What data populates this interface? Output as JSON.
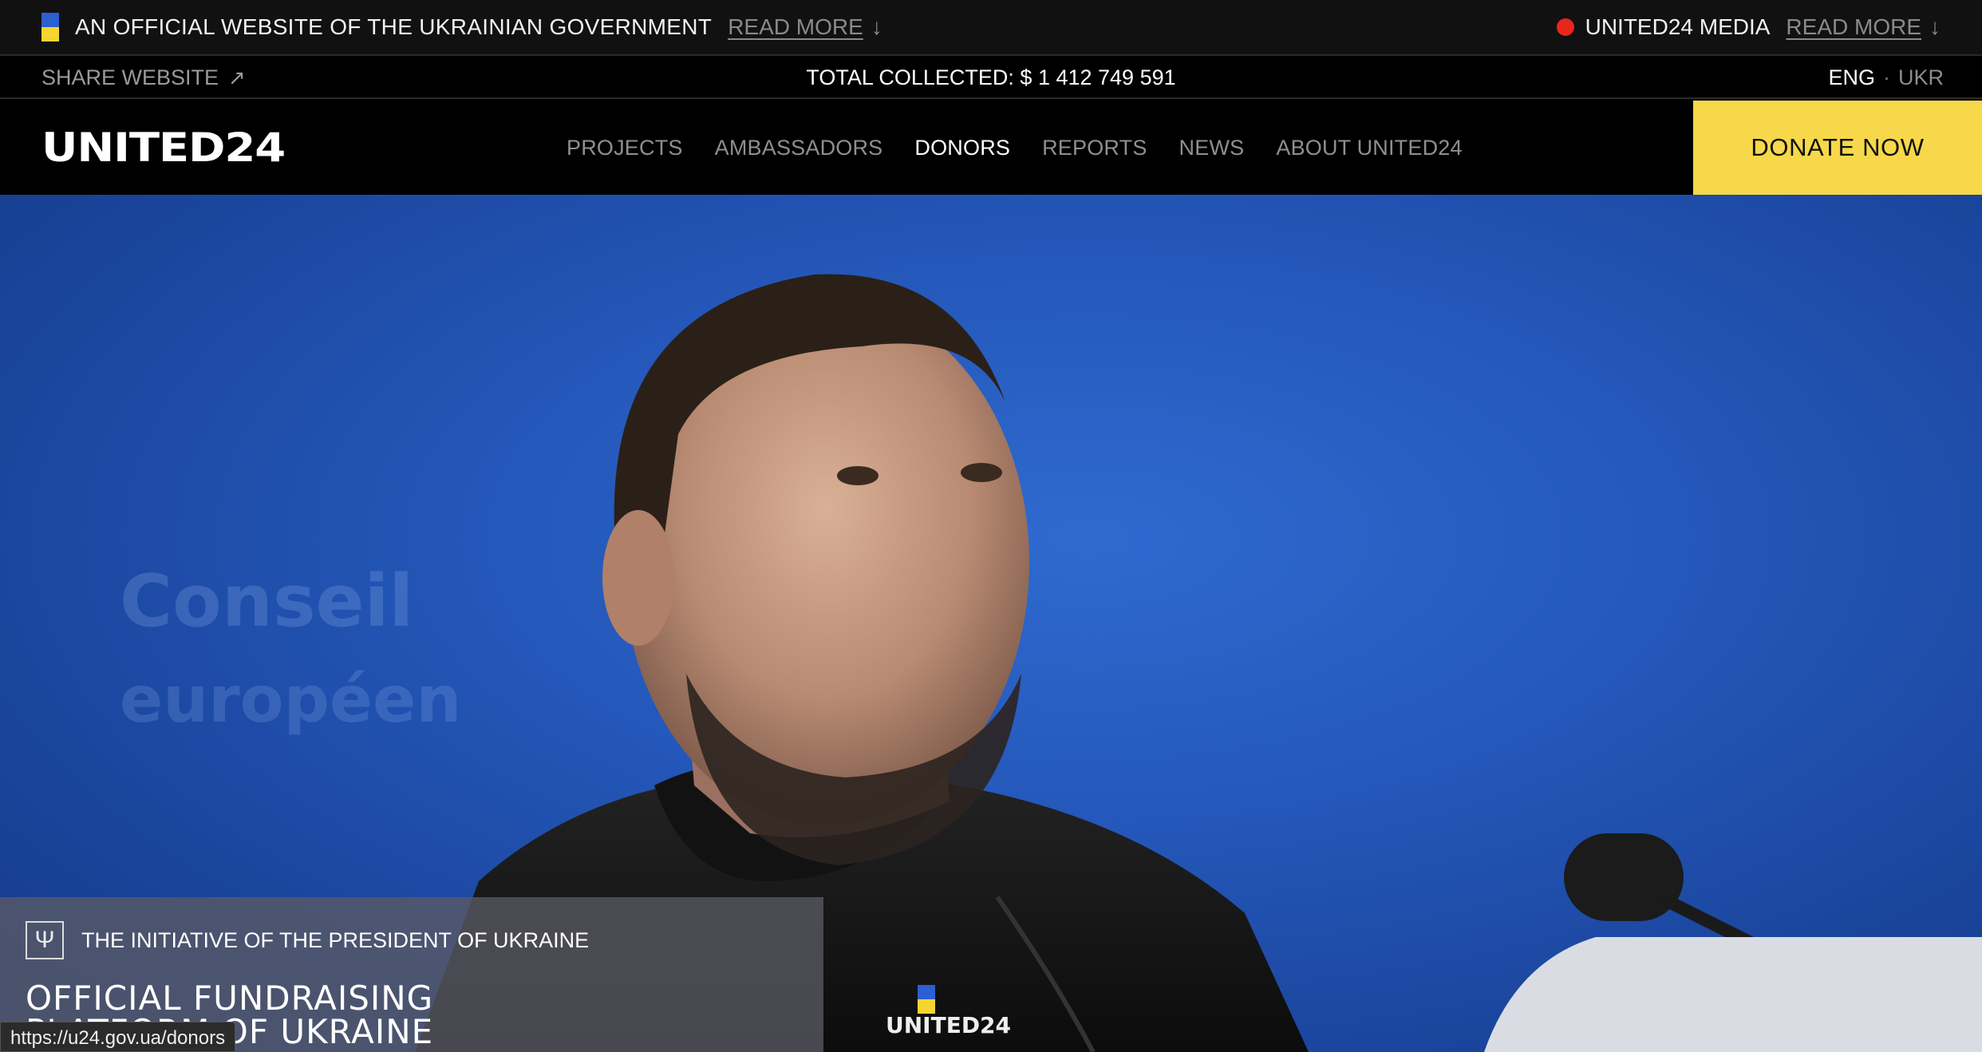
{
  "official_bar": {
    "text": "AN OFFICIAL WEBSITE OF THE UKRAINIAN GOVERNMENT",
    "read_more": "READ MORE",
    "media_text": "UNITED24 MEDIA",
    "media_read_more": "READ MORE",
    "arrow": "↓"
  },
  "info_bar": {
    "share": "SHARE WEBSITE",
    "share_arrow": "↗",
    "total_collected": "TOTAL COLLECTED: $ 1 412 749 591",
    "lang_eng": "ENG",
    "lang_sep": "·",
    "lang_ukr": "UKR"
  },
  "nav": {
    "logo": "UNITED24",
    "items": [
      {
        "label": "PROJECTS"
      },
      {
        "label": "AMBASSADORS"
      },
      {
        "label": "DONORS"
      },
      {
        "label": "REPORTS"
      },
      {
        "label": "NEWS"
      },
      {
        "label": "ABOUT UNITED24"
      }
    ],
    "active": "DONORS",
    "donate": "DONATE NOW"
  },
  "hero": {
    "initiative": "THE INITIATIVE OF THE PRESIDENT OF UKRAINE",
    "title_line1": "OFFICIAL FUNDRAISING",
    "title_line2": "PLATFORM OF UKRAINE",
    "trident_glyph": "Ψ",
    "shirt_logo": "UNITED24"
  },
  "status_bar": {
    "url": "https://u24.gov.ua/donors"
  },
  "colors": {
    "accent_yellow": "#f6d84a",
    "flag_blue": "#2c5fd0",
    "flag_yellow": "#f6d530",
    "live_red": "#e8261e",
    "hero_blue": "#2457b9"
  }
}
